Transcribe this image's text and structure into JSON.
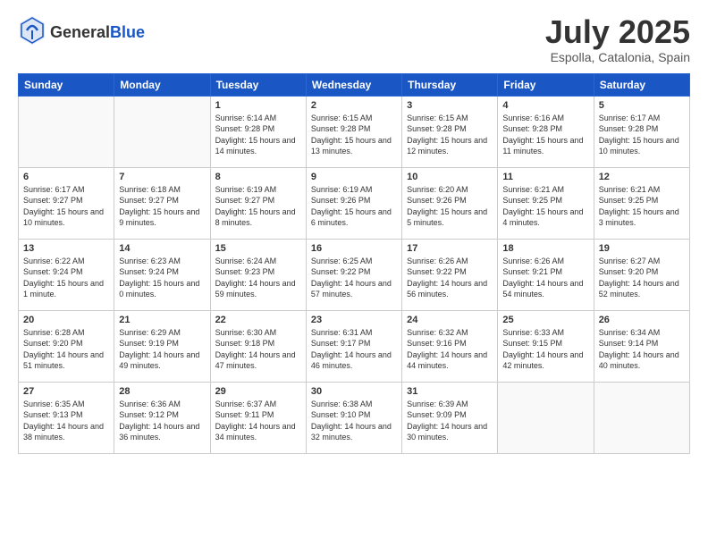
{
  "header": {
    "logo_general": "General",
    "logo_blue": "Blue",
    "month": "July 2025",
    "location": "Espolla, Catalonia, Spain"
  },
  "weekdays": [
    "Sunday",
    "Monday",
    "Tuesday",
    "Wednesday",
    "Thursday",
    "Friday",
    "Saturday"
  ],
  "weeks": [
    [
      {
        "day": "",
        "sunrise": "",
        "sunset": "",
        "daylight": ""
      },
      {
        "day": "",
        "sunrise": "",
        "sunset": "",
        "daylight": ""
      },
      {
        "day": "1",
        "sunrise": "Sunrise: 6:14 AM",
        "sunset": "Sunset: 9:28 PM",
        "daylight": "Daylight: 15 hours and 14 minutes."
      },
      {
        "day": "2",
        "sunrise": "Sunrise: 6:15 AM",
        "sunset": "Sunset: 9:28 PM",
        "daylight": "Daylight: 15 hours and 13 minutes."
      },
      {
        "day": "3",
        "sunrise": "Sunrise: 6:15 AM",
        "sunset": "Sunset: 9:28 PM",
        "daylight": "Daylight: 15 hours and 12 minutes."
      },
      {
        "day": "4",
        "sunrise": "Sunrise: 6:16 AM",
        "sunset": "Sunset: 9:28 PM",
        "daylight": "Daylight: 15 hours and 11 minutes."
      },
      {
        "day": "5",
        "sunrise": "Sunrise: 6:17 AM",
        "sunset": "Sunset: 9:28 PM",
        "daylight": "Daylight: 15 hours and 10 minutes."
      }
    ],
    [
      {
        "day": "6",
        "sunrise": "Sunrise: 6:17 AM",
        "sunset": "Sunset: 9:27 PM",
        "daylight": "Daylight: 15 hours and 10 minutes."
      },
      {
        "day": "7",
        "sunrise": "Sunrise: 6:18 AM",
        "sunset": "Sunset: 9:27 PM",
        "daylight": "Daylight: 15 hours and 9 minutes."
      },
      {
        "day": "8",
        "sunrise": "Sunrise: 6:19 AM",
        "sunset": "Sunset: 9:27 PM",
        "daylight": "Daylight: 15 hours and 8 minutes."
      },
      {
        "day": "9",
        "sunrise": "Sunrise: 6:19 AM",
        "sunset": "Sunset: 9:26 PM",
        "daylight": "Daylight: 15 hours and 6 minutes."
      },
      {
        "day": "10",
        "sunrise": "Sunrise: 6:20 AM",
        "sunset": "Sunset: 9:26 PM",
        "daylight": "Daylight: 15 hours and 5 minutes."
      },
      {
        "day": "11",
        "sunrise": "Sunrise: 6:21 AM",
        "sunset": "Sunset: 9:25 PM",
        "daylight": "Daylight: 15 hours and 4 minutes."
      },
      {
        "day": "12",
        "sunrise": "Sunrise: 6:21 AM",
        "sunset": "Sunset: 9:25 PM",
        "daylight": "Daylight: 15 hours and 3 minutes."
      }
    ],
    [
      {
        "day": "13",
        "sunrise": "Sunrise: 6:22 AM",
        "sunset": "Sunset: 9:24 PM",
        "daylight": "Daylight: 15 hours and 1 minute."
      },
      {
        "day": "14",
        "sunrise": "Sunrise: 6:23 AM",
        "sunset": "Sunset: 9:24 PM",
        "daylight": "Daylight: 15 hours and 0 minutes."
      },
      {
        "day": "15",
        "sunrise": "Sunrise: 6:24 AM",
        "sunset": "Sunset: 9:23 PM",
        "daylight": "Daylight: 14 hours and 59 minutes."
      },
      {
        "day": "16",
        "sunrise": "Sunrise: 6:25 AM",
        "sunset": "Sunset: 9:22 PM",
        "daylight": "Daylight: 14 hours and 57 minutes."
      },
      {
        "day": "17",
        "sunrise": "Sunrise: 6:26 AM",
        "sunset": "Sunset: 9:22 PM",
        "daylight": "Daylight: 14 hours and 56 minutes."
      },
      {
        "day": "18",
        "sunrise": "Sunrise: 6:26 AM",
        "sunset": "Sunset: 9:21 PM",
        "daylight": "Daylight: 14 hours and 54 minutes."
      },
      {
        "day": "19",
        "sunrise": "Sunrise: 6:27 AM",
        "sunset": "Sunset: 9:20 PM",
        "daylight": "Daylight: 14 hours and 52 minutes."
      }
    ],
    [
      {
        "day": "20",
        "sunrise": "Sunrise: 6:28 AM",
        "sunset": "Sunset: 9:20 PM",
        "daylight": "Daylight: 14 hours and 51 minutes."
      },
      {
        "day": "21",
        "sunrise": "Sunrise: 6:29 AM",
        "sunset": "Sunset: 9:19 PM",
        "daylight": "Daylight: 14 hours and 49 minutes."
      },
      {
        "day": "22",
        "sunrise": "Sunrise: 6:30 AM",
        "sunset": "Sunset: 9:18 PM",
        "daylight": "Daylight: 14 hours and 47 minutes."
      },
      {
        "day": "23",
        "sunrise": "Sunrise: 6:31 AM",
        "sunset": "Sunset: 9:17 PM",
        "daylight": "Daylight: 14 hours and 46 minutes."
      },
      {
        "day": "24",
        "sunrise": "Sunrise: 6:32 AM",
        "sunset": "Sunset: 9:16 PM",
        "daylight": "Daylight: 14 hours and 44 minutes."
      },
      {
        "day": "25",
        "sunrise": "Sunrise: 6:33 AM",
        "sunset": "Sunset: 9:15 PM",
        "daylight": "Daylight: 14 hours and 42 minutes."
      },
      {
        "day": "26",
        "sunrise": "Sunrise: 6:34 AM",
        "sunset": "Sunset: 9:14 PM",
        "daylight": "Daylight: 14 hours and 40 minutes."
      }
    ],
    [
      {
        "day": "27",
        "sunrise": "Sunrise: 6:35 AM",
        "sunset": "Sunset: 9:13 PM",
        "daylight": "Daylight: 14 hours and 38 minutes."
      },
      {
        "day": "28",
        "sunrise": "Sunrise: 6:36 AM",
        "sunset": "Sunset: 9:12 PM",
        "daylight": "Daylight: 14 hours and 36 minutes."
      },
      {
        "day": "29",
        "sunrise": "Sunrise: 6:37 AM",
        "sunset": "Sunset: 9:11 PM",
        "daylight": "Daylight: 14 hours and 34 minutes."
      },
      {
        "day": "30",
        "sunrise": "Sunrise: 6:38 AM",
        "sunset": "Sunset: 9:10 PM",
        "daylight": "Daylight: 14 hours and 32 minutes."
      },
      {
        "day": "31",
        "sunrise": "Sunrise: 6:39 AM",
        "sunset": "Sunset: 9:09 PM",
        "daylight": "Daylight: 14 hours and 30 minutes."
      },
      {
        "day": "",
        "sunrise": "",
        "sunset": "",
        "daylight": ""
      },
      {
        "day": "",
        "sunrise": "",
        "sunset": "",
        "daylight": ""
      }
    ]
  ]
}
